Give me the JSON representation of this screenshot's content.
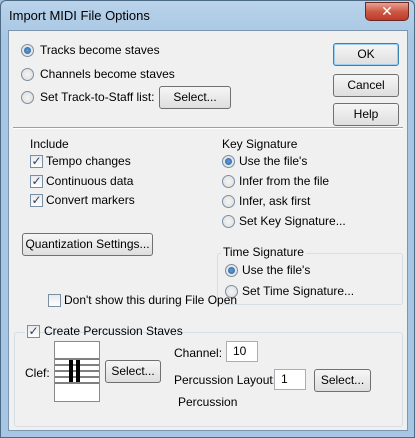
{
  "window": {
    "title": "Import MIDI File Options",
    "close_glyph": "✕"
  },
  "mode": {
    "options": [
      {
        "label": "Tracks become staves",
        "selected": true
      },
      {
        "label": "Channels become staves",
        "selected": false
      },
      {
        "label": "Set Track-to-Staff list:",
        "selected": false
      }
    ],
    "select_button": "Select..."
  },
  "buttons": {
    "ok": "OK",
    "cancel": "Cancel",
    "help": "Help"
  },
  "include": {
    "title": "Include",
    "items": [
      {
        "label": "Tempo changes",
        "checked": true
      },
      {
        "label": "Continuous data",
        "checked": true
      },
      {
        "label": "Convert markers",
        "checked": true
      }
    ]
  },
  "key_signature": {
    "title": "Key Signature",
    "options": [
      {
        "label": "Use the file's",
        "selected": true
      },
      {
        "label": "Infer from the file",
        "selected": false
      },
      {
        "label": "Infer, ask first",
        "selected": false
      },
      {
        "label": "Set Key Signature...",
        "selected": false
      }
    ]
  },
  "quantization_button": "Quantization Settings...",
  "time_signature": {
    "title": "Time Signature",
    "options": [
      {
        "label": "Use the file's",
        "selected": true
      },
      {
        "label": "Set Time Signature...",
        "selected": false
      }
    ]
  },
  "dont_show": {
    "label": "Don't show this during File Open",
    "checked": false
  },
  "percussion": {
    "title": "Create Percussion Staves",
    "checked": true,
    "clef_label": "Clef:",
    "clef_select": "Select...",
    "channel_label": "Channel:",
    "channel_value": "10",
    "layout_label": "Percussion Layout:",
    "layout_value": "1",
    "layout_select": "Select...",
    "layout_name": "Percussion"
  },
  "check_glyph": "✓"
}
